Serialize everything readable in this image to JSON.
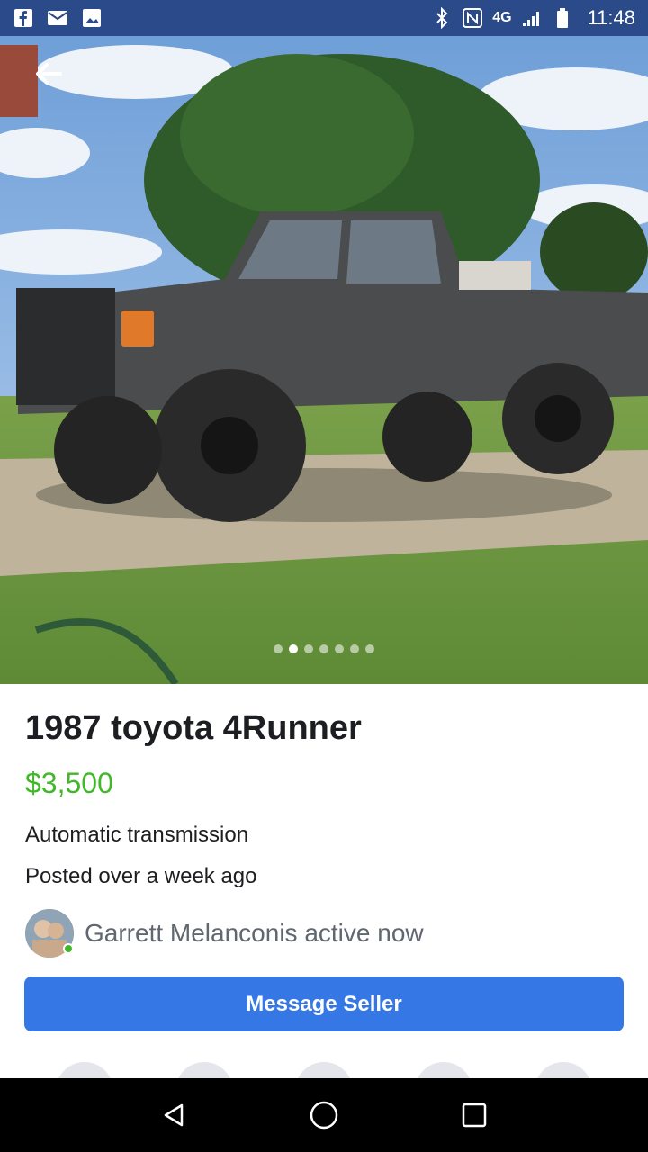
{
  "status_bar": {
    "time": "11:48",
    "network": "4G",
    "left_icons": [
      "facebook-icon",
      "mail-icon",
      "image-icon"
    ],
    "right_icons": [
      "bluetooth-icon",
      "nfc-icon",
      "signal-icon",
      "battery-icon"
    ]
  },
  "photo": {
    "image_count": 7,
    "active_index": 1
  },
  "listing": {
    "title": "1987 toyota 4Runner",
    "price": "$3,500",
    "transmission": "Automatic transmission",
    "posted": "Posted over a week ago",
    "seller_status": "Garrett Melanconis active now"
  },
  "actions": {
    "message_seller_label": "Message Seller"
  },
  "colors": {
    "status_bar": "#2a4a8a",
    "price": "#42b72a",
    "button": "#3578e5",
    "online": "#42b72a"
  }
}
